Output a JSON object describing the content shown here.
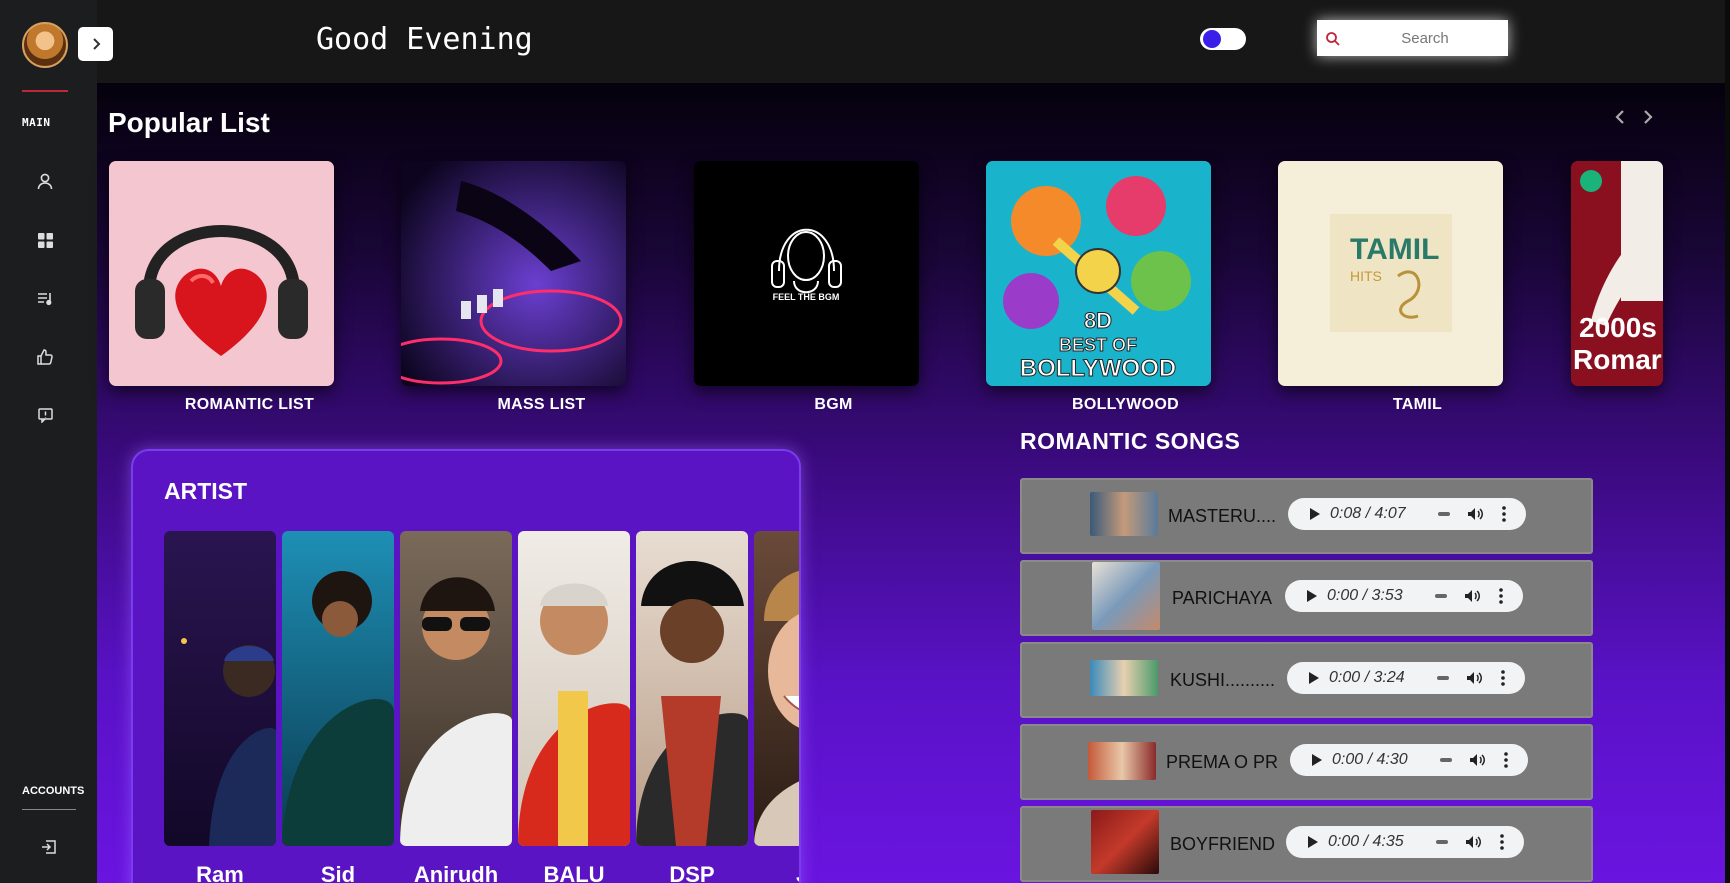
{
  "sidebar": {
    "main_label": "MAIN",
    "accounts_label": "ACCOUNTS",
    "icons": [
      "user-icon",
      "grid-icon",
      "playlist-icon",
      "thumbs-up-icon",
      "message-icon"
    ],
    "logout_icon": "logout-icon"
  },
  "header": {
    "greeting": "Good Evening",
    "search_placeholder": "Search"
  },
  "popular": {
    "title": "Popular List",
    "items": [
      {
        "label": "ROMANTIC LIST"
      },
      {
        "label": "MASS LIST"
      },
      {
        "label": "BGM",
        "art_text": "FEEL THE BGM"
      },
      {
        "label": "BOLLYWOOD",
        "art_text_1": "8D",
        "art_text_2": "BEST OF",
        "art_text_3": "BOLLYWOOD"
      },
      {
        "label": "TAMIL",
        "art_text_1": "TAMIL",
        "art_text_2": "HITS"
      },
      {
        "label": "",
        "art_text_1": "2000s",
        "art_text_2": "Romar"
      }
    ]
  },
  "artists": {
    "title": "ARTIST",
    "items": [
      {
        "name": "Ram"
      },
      {
        "name": "Sid"
      },
      {
        "name": "Anirudh"
      },
      {
        "name": "BALU"
      },
      {
        "name": "DSP"
      },
      {
        "name": "JB"
      }
    ]
  },
  "songs": {
    "title": "ROMANTIC SONGS",
    "items": [
      {
        "title": "MASTERU....",
        "time": "0:08 / 4:07"
      },
      {
        "title": "PARICHAYA",
        "time": "0:00 / 3:53"
      },
      {
        "title": "KUSHI..........",
        "time": "0:00 / 3:24"
      },
      {
        "title": "PREMA O PR",
        "time": "0:00 / 4:30"
      },
      {
        "title": "BOYFRIEND",
        "time": "0:00 / 4:35"
      }
    ]
  }
}
